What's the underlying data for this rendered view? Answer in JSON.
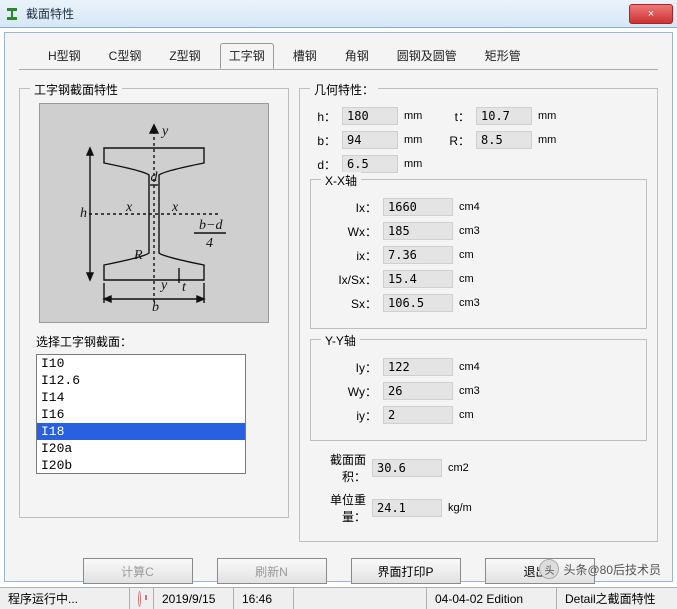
{
  "window": {
    "title": "截面特性",
    "close_icon": "×"
  },
  "tabs": [
    {
      "label": "H型钢"
    },
    {
      "label": "C型钢"
    },
    {
      "label": "Z型钢"
    },
    {
      "label": "工字钢",
      "active": true
    },
    {
      "label": "槽钢"
    },
    {
      "label": "角钢"
    },
    {
      "label": "圆钢及圆管"
    },
    {
      "label": "矩形管"
    }
  ],
  "left": {
    "group_title": "工字钢截面特性",
    "select_label": "选择工字钢截面：",
    "items": [
      "I10",
      "I12.6",
      "I14",
      "I16",
      "I18",
      "I20a",
      "I20b"
    ],
    "selected": "I18"
  },
  "geo": {
    "title": "几何特性：",
    "h": {
      "label": "h：",
      "value": "180",
      "unit": "mm"
    },
    "t": {
      "label": "t：",
      "value": "10.7",
      "unit": "mm"
    },
    "b": {
      "label": "b：",
      "value": "94",
      "unit": "mm"
    },
    "R": {
      "label": "R：",
      "value": "8.5",
      "unit": "mm"
    },
    "d": {
      "label": "d：",
      "value": "6.5",
      "unit": "mm"
    }
  },
  "xaxis": {
    "title": "X-X轴",
    "Ix": {
      "label": "Ix：",
      "value": "1660",
      "unit": "cm4"
    },
    "Wx": {
      "label": "Wx：",
      "value": "185",
      "unit": "cm3"
    },
    "ix": {
      "label": "ix：",
      "value": "7.36",
      "unit": "cm"
    },
    "IxSx": {
      "label": "Ix/Sx：",
      "value": "15.4",
      "unit": "cm"
    },
    "Sx": {
      "label": "Sx：",
      "value": "106.5",
      "unit": "cm3"
    }
  },
  "yaxis": {
    "title": "Y-Y轴",
    "Iy": {
      "label": "Iy：",
      "value": "122",
      "unit": "cm4"
    },
    "Wy": {
      "label": "Wy：",
      "value": "26",
      "unit": "cm3"
    },
    "iy": {
      "label": "iy：",
      "value": "2",
      "unit": "cm"
    }
  },
  "area": {
    "label": "截面面积：",
    "value": "30.6",
    "unit": "cm2"
  },
  "weight": {
    "label": "单位重量：",
    "value": "24.1",
    "unit": "kg/m"
  },
  "buttons": {
    "calc": "计算C",
    "refresh": "刷新N",
    "print": "界面打印P",
    "exit": "退出E"
  },
  "statusbar": {
    "running": "程序运行中...",
    "date": "2019/9/15",
    "time": "16:46",
    "edition": "04-04-02 Edition",
    "detail": "Detail之截面特性"
  },
  "watermark": {
    "text": "头条@80后技术员"
  }
}
